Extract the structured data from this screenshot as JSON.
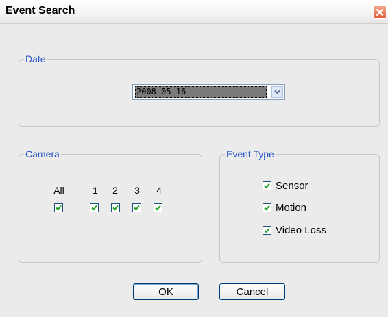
{
  "window": {
    "title": "Event Search"
  },
  "date_group": {
    "legend": "Date",
    "selected_date": "2008-05-16"
  },
  "camera_group": {
    "legend": "Camera",
    "cameras": [
      {
        "label": "All",
        "checked": true
      },
      {
        "label": "1",
        "checked": true
      },
      {
        "label": "2",
        "checked": true
      },
      {
        "label": "3",
        "checked": true
      },
      {
        "label": "4",
        "checked": true
      }
    ]
  },
  "event_type_group": {
    "legend": "Event Type",
    "types": [
      {
        "label": "Sensor",
        "checked": true
      },
      {
        "label": "Motion",
        "checked": true
      },
      {
        "label": "Video Loss",
        "checked": true
      }
    ]
  },
  "buttons": {
    "ok": "OK",
    "cancel": "Cancel"
  },
  "colors": {
    "legend": "#2655c8",
    "check": "#21a121",
    "close_button": "#e25b34"
  }
}
